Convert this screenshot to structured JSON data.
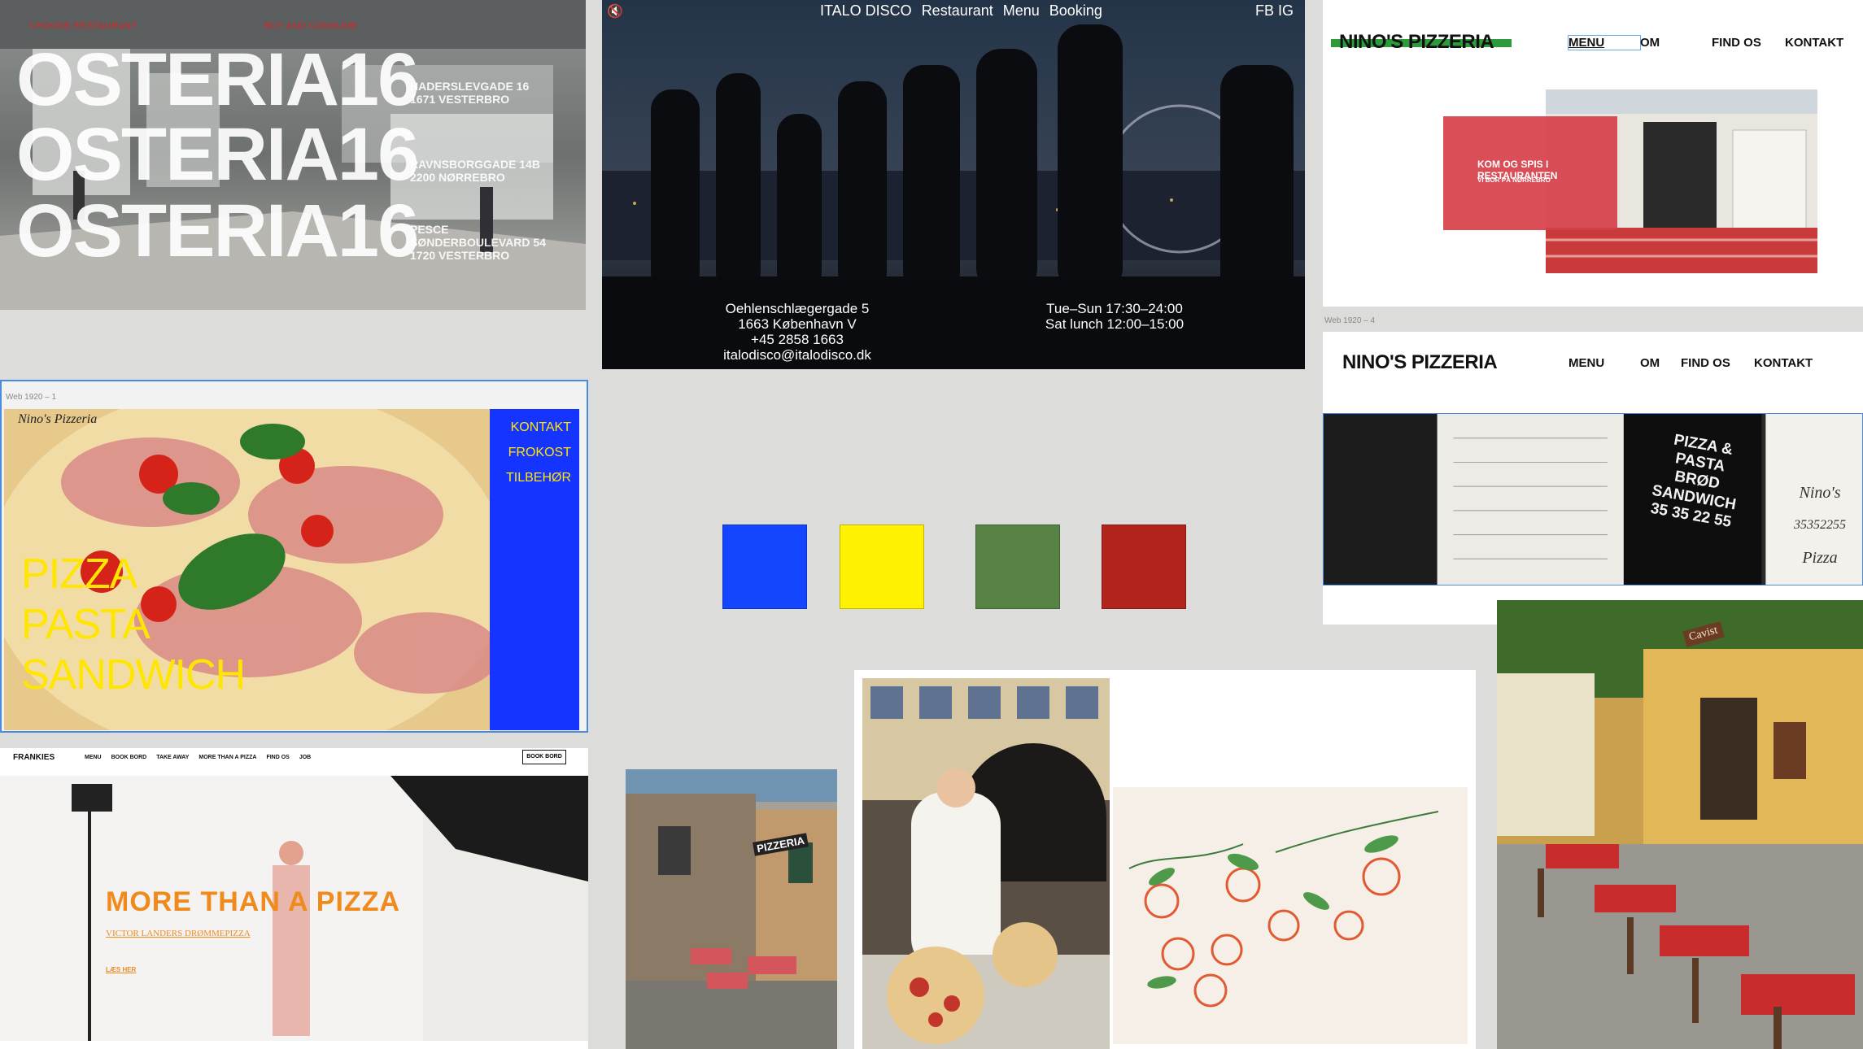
{
  "osteria": {
    "top_left_label": "CHOOSE RESTAURANT",
    "top_right_label": "BUY AND CONSUME",
    "brand_lines": [
      "OSTERIA16",
      "OSTERIA16",
      "OSTERIA16"
    ],
    "addresses": [
      [
        "HADERSLEVGADE 16",
        "1671 VESTERBRO"
      ],
      [
        "RAVNSBORGGADE 14B",
        "2200 NØRREBRO"
      ],
      [
        "PESCE",
        "SØNDERBOULEVARD 54",
        "1720 VESTERBRO"
      ]
    ]
  },
  "italo": {
    "mute_icon": "speaker-mute-icon",
    "nav": [
      "ITALO DISCO",
      "Restaurant",
      "Menu",
      "Booking"
    ],
    "social": "FB IG",
    "address_lines": [
      "Oehlenschlægergade 5",
      "1663 København V",
      "+45 2858 1663",
      "italodisco@italodisco.dk"
    ],
    "hours_lines": [
      "Tue–Sun 17:30–24:00",
      "Sat lunch 12:00–15:00"
    ]
  },
  "nino_top": {
    "logo": "NINO'S PIZZERIA",
    "nav": [
      "MENU",
      "OM",
      "FIND OS",
      "KONTAKT"
    ],
    "cta_title": "KOM OG SPIS I RESTAURANTEN",
    "cta_subtitle": "VI BOR PÅ NØRREBRO"
  },
  "nino_bottom": {
    "caption": "Web 1920 – 4",
    "logo": "NINO'S PIZZERIA",
    "nav": [
      "MENU",
      "OM",
      "FIND OS",
      "KONTAKT"
    ],
    "window_text": [
      "PIZZA & PASTA",
      "BRØD",
      "SANDWICH",
      "35 35 22 55"
    ],
    "side_sign": [
      "Nino's",
      "35352255",
      "Pizza"
    ]
  },
  "pizza_panel": {
    "caption": "Web 1920 – 1",
    "script_logo": "Nino's Pizzeria",
    "nav": [
      "KONTAKT",
      "FROKOST",
      "TILBEHØR"
    ],
    "words": [
      "PIZZA",
      "PASTA",
      "SANDWICH"
    ]
  },
  "swatches": [
    "#1446ff",
    "#fff200",
    "#568244",
    "#b0241b"
  ],
  "frankies": {
    "logo": "FRANKIES",
    "nav": [
      "MENU",
      "BOOK BORD",
      "TAKE AWAY",
      "MORE THAN A PIZZA",
      "FIND OS",
      "JOB"
    ],
    "book_button": "BOOK BORD",
    "headline": "MORE THAN A PIZZA",
    "subline": "VICTOR LANDERS DRØMMEPIZZA",
    "link": "LÆS HER"
  },
  "restaurant_sign": "PIZZERIA",
  "greek_sign": "Cavist"
}
